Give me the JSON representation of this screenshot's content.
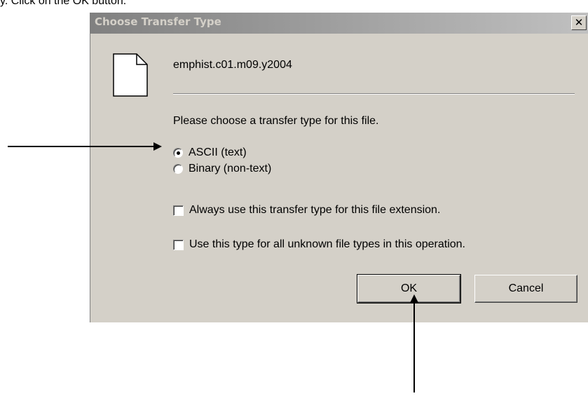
{
  "instruction": "y.  Click on the OK button.",
  "dialog": {
    "title": "Choose Transfer Type",
    "close_glyph": "✕",
    "filename": "emphist.c01.m09.y2004",
    "prompt": "Please choose a transfer type for this file.",
    "transfer_types": [
      {
        "label": "ASCII (text)",
        "selected": true
      },
      {
        "label": "Binary (non-text)",
        "selected": false
      }
    ],
    "options": [
      {
        "label": "Always use this transfer type for this file extension.",
        "checked": false
      },
      {
        "label": "Use this type for all unknown file types in this operation.",
        "checked": false
      }
    ],
    "ok_label": "OK",
    "cancel_label": "Cancel"
  },
  "icons": {
    "file": "file-icon",
    "close": "close-icon",
    "annotation_arrow": "arrow-icon"
  },
  "colors": {
    "dialog_bg": "#d4d0c8",
    "titlebar_inactive": "#808080",
    "title_text": "#d4d0c8"
  }
}
